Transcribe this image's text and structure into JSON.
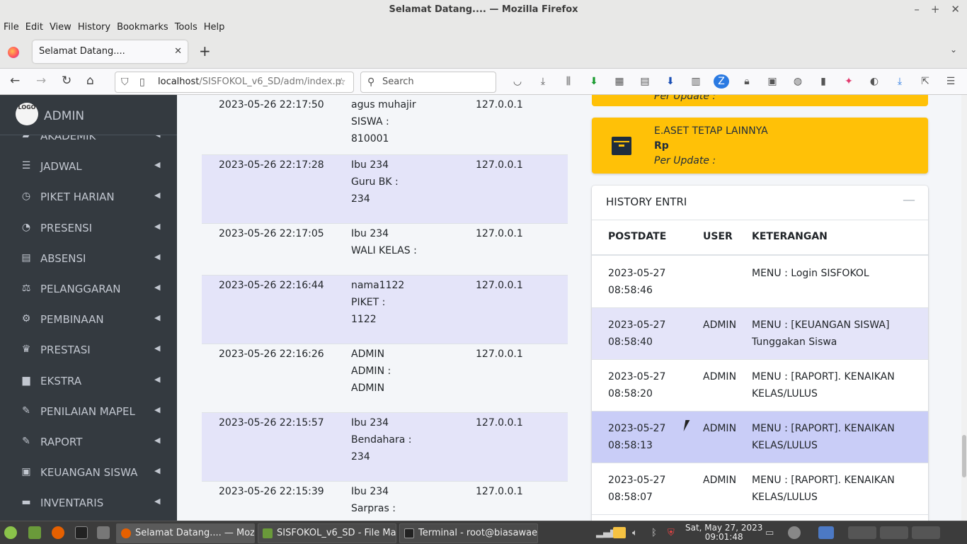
{
  "window": {
    "title": "Selamat Datang.... — Mozilla Firefox"
  },
  "menu": [
    "File",
    "Edit",
    "View",
    "History",
    "Bookmarks",
    "Tools",
    "Help"
  ],
  "tab": {
    "title": "Selamat Datang...."
  },
  "url": {
    "host": "localhost",
    "path": "/SISFOKOL_v6_SD/adm/index.p"
  },
  "search": {
    "placeholder": "Search"
  },
  "sidebar": {
    "brand": "ADMIN",
    "logo": "LOGO",
    "items": [
      {
        "label": "AKADEMIK",
        "icon": "book-icon"
      },
      {
        "label": "JADWAL",
        "icon": "list-icon"
      },
      {
        "label": "PIKET HARIAN",
        "icon": "clock-icon"
      },
      {
        "label": "PRESENSI",
        "icon": "gauge-icon"
      },
      {
        "label": "ABSENSI",
        "icon": "newspaper-icon"
      },
      {
        "label": "PELANGGARAN",
        "icon": "scale-icon"
      },
      {
        "label": "PEMBINAAN",
        "icon": "cogs-icon"
      },
      {
        "label": "PRESTASI",
        "icon": "trophy-icon"
      },
      {
        "label": "EKSTRA",
        "icon": "briefcase-icon"
      },
      {
        "label": "PENILAIAN MAPEL",
        "icon": "pencil-icon"
      },
      {
        "label": "RAPORT",
        "icon": "pencil-icon"
      },
      {
        "label": "KEUANGAN SISWA",
        "icon": "money-icon"
      },
      {
        "label": "INVENTARIS",
        "icon": "archive-icon"
      }
    ]
  },
  "login_rows": [
    {
      "date": "2023-05-26 22:17:50",
      "user": [
        "agus muhajir",
        "SISWA :",
        "810001"
      ],
      "ip": "127.0.0.1"
    },
    {
      "date": "2023-05-26 22:17:28",
      "user": [
        "Ibu 234",
        "Guru BK :",
        "234"
      ],
      "ip": "127.0.0.1"
    },
    {
      "date": "2023-05-26 22:17:05",
      "user": [
        "Ibu 234",
        "WALI KELAS :"
      ],
      "ip": "127.0.0.1"
    },
    {
      "date": "2023-05-26 22:16:44",
      "user": [
        "nama1122",
        "PIKET :",
        "1122"
      ],
      "ip": "127.0.0.1"
    },
    {
      "date": "2023-05-26 22:16:26",
      "user": [
        "ADMIN",
        "ADMIN :",
        "ADMIN"
      ],
      "ip": "127.0.0.1"
    },
    {
      "date": "2023-05-26 22:15:57",
      "user": [
        "Ibu 234",
        "Bendahara :",
        "234"
      ],
      "ip": "127.0.0.1"
    },
    {
      "date": "2023-05-26 22:15:39",
      "user": [
        "Ibu 234",
        "Sarpras :"
      ],
      "ip": "127.0.0.1"
    }
  ],
  "info_top": {
    "subtitle": "Per Update :"
  },
  "info_box": {
    "title": "E.ASET TETAP LAINNYA",
    "value": "Rp",
    "subtitle": "Per Update :"
  },
  "history": {
    "title": "HISTORY ENTRI",
    "headers": [
      "POSTDATE",
      "USER",
      "KETERANGAN"
    ],
    "rows": [
      {
        "date": "2023-05-27 08:58:46",
        "user": "",
        "ket": "MENU : Login SISFOKOL"
      },
      {
        "date": "2023-05-27 08:58:40",
        "user": "ADMIN",
        "ket": "MENU : [KEUANGAN SISWA] Tunggakan Siswa"
      },
      {
        "date": "2023-05-27 08:58:20",
        "user": "ADMIN",
        "ket": "MENU : [RAPORT]. KENAIKAN KELAS/LULUS"
      },
      {
        "date": "2023-05-27 08:58:13",
        "user": "ADMIN",
        "ket": "MENU : [RAPORT]. KENAIKAN KELAS/LULUS"
      },
      {
        "date": "2023-05-27 08:58:07",
        "user": "ADMIN",
        "ket": "MENU : [RAPORT]. KENAIKAN KELAS/LULUS"
      }
    ]
  },
  "taskbar": {
    "tasks": [
      "Selamat Datang.... — Mozilla...",
      "SISFOKOL_v6_SD - File Mana...",
      "Terminal - root@biasawae /..."
    ],
    "clock_date": "Sat, May 27, 2023",
    "clock_time": "09:01:48"
  }
}
